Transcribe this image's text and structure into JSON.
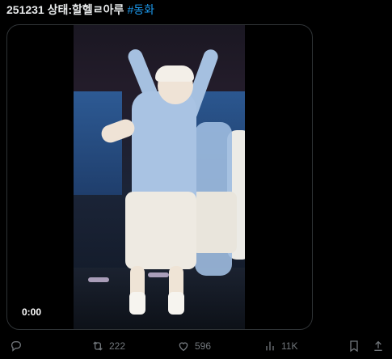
{
  "tweet": {
    "text": "251231 상태:할헬ㄹ아루",
    "hashtag": "#동화"
  },
  "media": {
    "timecode": "0:00"
  },
  "actions": {
    "retweets": "222",
    "likes": "596",
    "views": "11K"
  },
  "colors": {
    "background": "#000000",
    "text": "#e7e9ea",
    "muted": "#71767b",
    "accent": "#1d9bf0",
    "border": "#2f3336"
  }
}
